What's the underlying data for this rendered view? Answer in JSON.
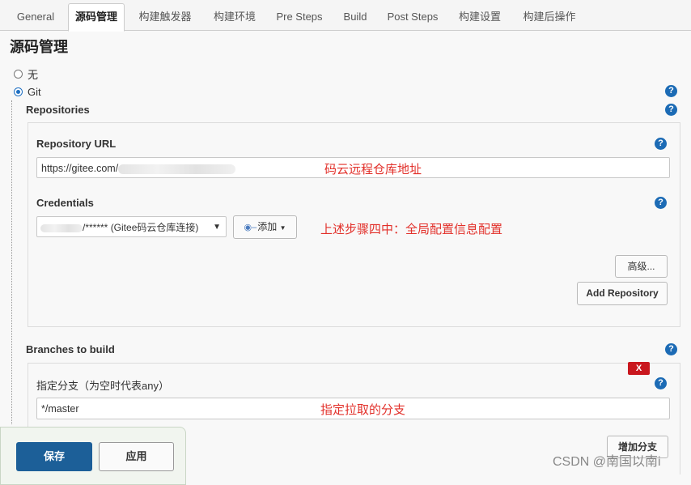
{
  "tabs": [
    {
      "label": "General"
    },
    {
      "label": "源码管理"
    },
    {
      "label": "构建触发器"
    },
    {
      "label": "构建环境"
    },
    {
      "label": "Pre Steps"
    },
    {
      "label": "Build"
    },
    {
      "label": "Post Steps"
    },
    {
      "label": "构建设置"
    },
    {
      "label": "构建后操作"
    }
  ],
  "section_title": "源码管理",
  "scm": {
    "none_label": "无",
    "git_label": "Git",
    "selected": "Git"
  },
  "repositories": {
    "title": "Repositories",
    "url_label": "Repository URL",
    "url_value": "https://gitee.com/",
    "url_annotation": "码云远程仓库地址",
    "credentials_label": "Credentials",
    "credentials_value": "/****** (Gitee码云仓库连接)",
    "credentials_annotation": "上述步骤四中：全局配置信息配置",
    "add_label": "添加",
    "advanced_label": "高级...",
    "add_repository_label": "Add Repository"
  },
  "branches": {
    "title": "Branches to build",
    "spec_label": "指定分支（为空时代表any）",
    "spec_value": "*/master",
    "spec_annotation": "指定拉取的分支",
    "delete_label": "X",
    "add_branch_label": "增加分支"
  },
  "footer": {
    "save_label": "保存",
    "apply_label": "应用"
  },
  "help_glyph": "?",
  "watermark": "CSDN @南国以南i",
  "colors": {
    "primary": "#1c5f98",
    "help": "#1c6bb5",
    "annotation": "#e2302a",
    "danger": "#c9171e"
  }
}
